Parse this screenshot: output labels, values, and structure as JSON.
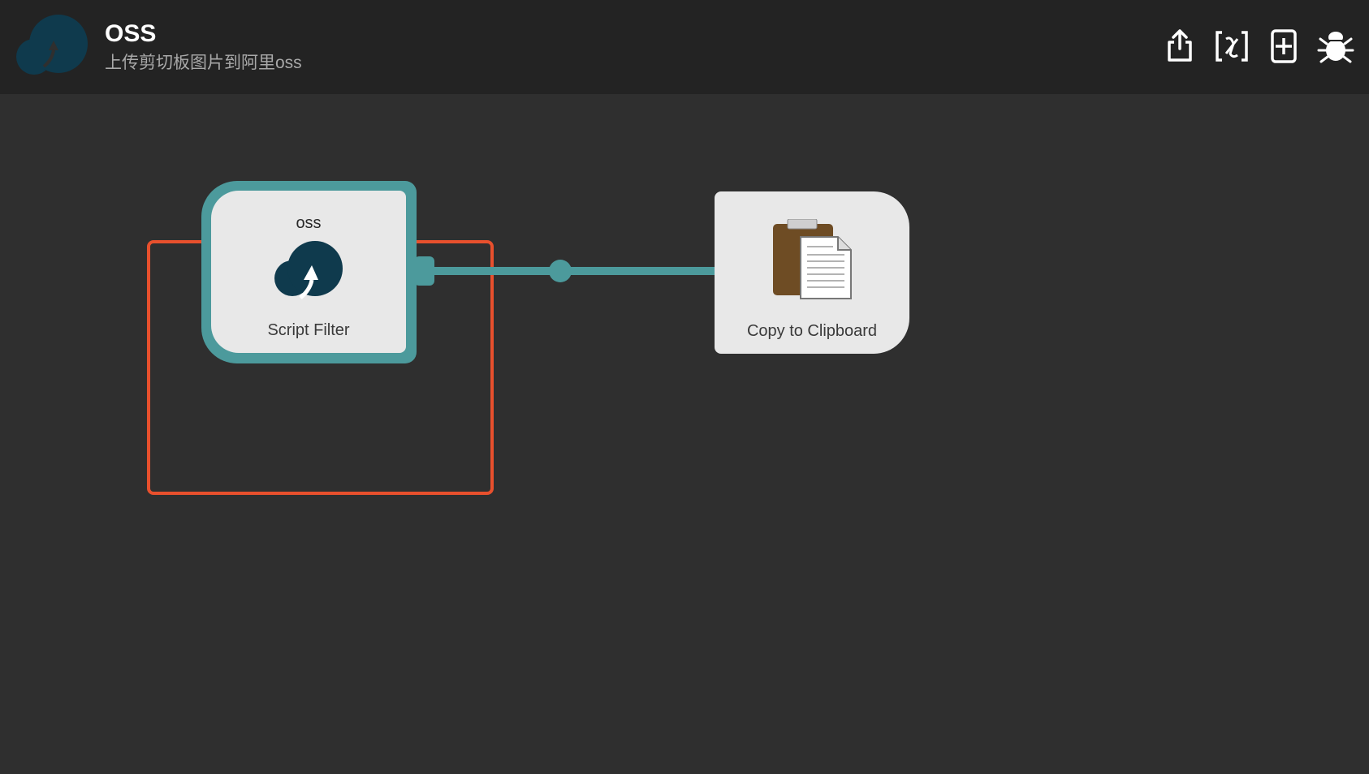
{
  "header": {
    "title": "OSS",
    "subtitle": "上传剪切板图片到阿里oss",
    "actions": [
      {
        "name": "export-icon"
      },
      {
        "name": "variables-icon"
      },
      {
        "name": "add-object-icon"
      },
      {
        "name": "debug-icon"
      }
    ]
  },
  "colors": {
    "header_bg": "#232323",
    "canvas_bg": "#2f2f2f",
    "accent_teal": "#4c9a9c",
    "selection": "#e8502d",
    "node_bg": "#e8e8e8",
    "cloud": "#0f3a4d"
  },
  "nodes": {
    "script_filter": {
      "keyword": "oss",
      "label": "Script Filter",
      "icon": "cloud-upload-icon"
    },
    "copy_clipboard": {
      "label": "Copy to Clipboard",
      "icon": "clipboard-icon"
    }
  }
}
